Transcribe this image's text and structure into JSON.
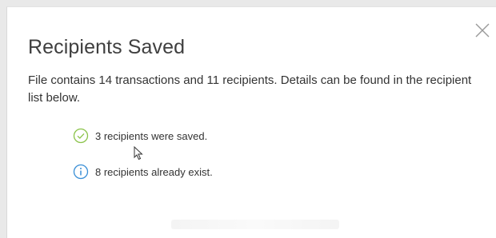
{
  "dialog": {
    "title": "Recipients Saved",
    "description": "File contains 14 transactions and 11 recipients. Details can be found in the recipient list below.",
    "close_icon": "close-icon",
    "statuses": [
      {
        "icon": "check-circle-icon",
        "color": "#8bc34a",
        "text": "3 recipients were saved."
      },
      {
        "icon": "info-circle-icon",
        "color": "#3a8fd6",
        "text": "8 recipients already exist."
      }
    ]
  }
}
